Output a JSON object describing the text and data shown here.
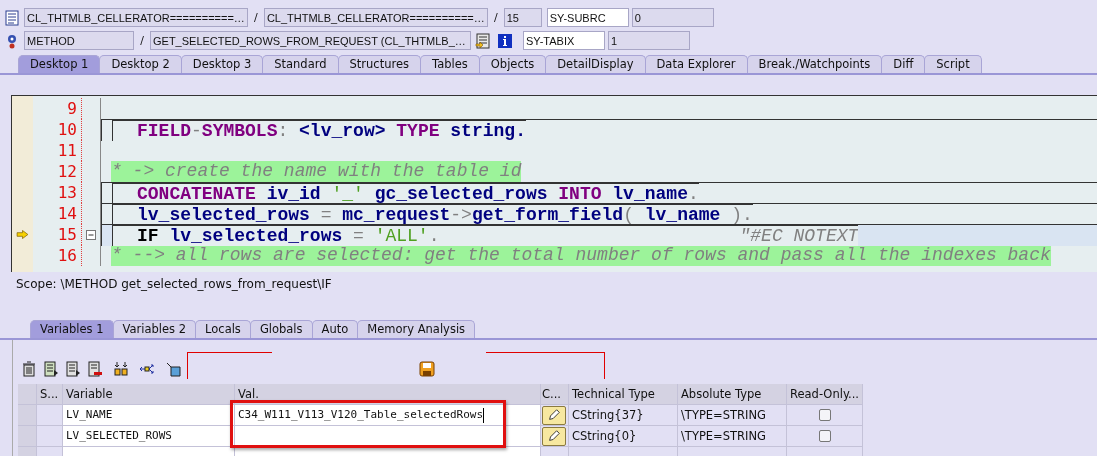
{
  "header": {
    "rows": [
      {
        "fields": [
          {
            "kind": "field",
            "text": "CL_THTMLB_CELLERATOR==========…"
          },
          {
            "kind": "sep",
            "text": "/"
          },
          {
            "kind": "field",
            "text": "CL_THTMLB_CELLERATOR==========…"
          },
          {
            "kind": "sep",
            "text": "/"
          },
          {
            "kind": "field",
            "text": "15"
          },
          {
            "kind": "label",
            "text": "SY-SUBRC"
          },
          {
            "kind": "field",
            "text": "0"
          }
        ]
      },
      {
        "fields": [
          {
            "kind": "field",
            "text": "METHOD"
          },
          {
            "kind": "sep",
            "text": "/"
          },
          {
            "kind": "field",
            "text": "GET_SELECTED_ROWS_FROM_REQUEST (CL_THTMLB_…"
          },
          {
            "kind": "icon"
          },
          {
            "kind": "label",
            "text": "SY-TABIX"
          },
          {
            "kind": "field",
            "text": "1"
          }
        ]
      }
    ]
  },
  "tabs": [
    {
      "label": "Desktop 1",
      "selected": true
    },
    {
      "label": "Desktop 2",
      "selected": false
    },
    {
      "label": "Desktop 3",
      "selected": false
    },
    {
      "label": "Standard",
      "selected": false
    },
    {
      "label": "Structures",
      "selected": false
    },
    {
      "label": "Tables",
      "selected": false
    },
    {
      "label": "Objects",
      "selected": false
    },
    {
      "label": "DetailDisplay",
      "selected": false
    },
    {
      "label": "Data Explorer",
      "selected": false
    },
    {
      "label": "Break./Watchpoints",
      "selected": false
    },
    {
      "label": "Diff",
      "selected": false
    },
    {
      "label": "Script",
      "selected": false
    }
  ],
  "code": {
    "lines": [
      {
        "number": "9",
        "kind": "blank",
        "current": false,
        "fold": false
      },
      {
        "number": "10",
        "kind": "code",
        "current": false,
        "fold": false,
        "segments": [
          {
            "kind": "kw",
            "text": "FIELD"
          },
          {
            "kind": "op",
            "text": "-"
          },
          {
            "kind": "kw",
            "text": "SYMBOLS"
          },
          {
            "kind": "op",
            "text": ":"
          },
          {
            "kind": "id",
            "text": " <lv_row> "
          },
          {
            "kind": "kw",
            "text": "TYPE"
          },
          {
            "kind": "id",
            "text": " string."
          }
        ]
      },
      {
        "number": "11",
        "kind": "blank",
        "current": false,
        "fold": false
      },
      {
        "number": "12",
        "kind": "comment",
        "current": false,
        "fold": false,
        "segments": [
          {
            "kind": "comment",
            "text": "* -> create the name with the table id"
          }
        ]
      },
      {
        "number": "13",
        "kind": "code",
        "current": false,
        "fold": false,
        "segments": [
          {
            "kind": "kw",
            "text": "CONCATENATE"
          },
          {
            "kind": "id",
            "text": " iv_id "
          },
          {
            "kind": "str",
            "text": "'_'"
          },
          {
            "kind": "id",
            "text": " gc_selected_rows "
          },
          {
            "kind": "kw",
            "text": "INTO"
          },
          {
            "kind": "id",
            "text": " lv_name"
          },
          {
            "kind": "op",
            "text": "."
          }
        ]
      },
      {
        "number": "14",
        "kind": "code",
        "current": false,
        "fold": false,
        "segments": [
          {
            "kind": "id",
            "text": "lv_selected_rows "
          },
          {
            "kind": "op",
            "text": "="
          },
          {
            "kind": "id",
            "text": " mc_request"
          },
          {
            "kind": "op",
            "text": "->"
          },
          {
            "kind": "id",
            "text": "get_form_field"
          },
          {
            "kind": "op",
            "text": "("
          },
          {
            "kind": "id",
            "text": " lv_name "
          },
          {
            "kind": "op",
            "text": ")."
          }
        ]
      },
      {
        "number": "15",
        "kind": "code",
        "current": true,
        "fold": true,
        "segments": [
          {
            "kind": "plain",
            "text": "IF"
          },
          {
            "kind": "id",
            "text": " lv_selected_rows "
          },
          {
            "kind": "op",
            "text": "="
          },
          {
            "kind": "str",
            "text": " 'ALL'"
          },
          {
            "kind": "op",
            "text": "."
          },
          {
            "kind": "note",
            "text": "\"#EC NOTEXT"
          }
        ]
      },
      {
        "number": "16",
        "kind": "comment",
        "current": false,
        "fold": false,
        "segments": [
          {
            "kind": "comment",
            "text": "* --> all rows are selected: get the total number of rows and pass all the indexes back"
          }
        ]
      }
    ]
  },
  "scope": "Scope: \\METHOD get_selected_rows_from_request\\IF",
  "subtabs": [
    {
      "label": "Variables 1",
      "selected": true
    },
    {
      "label": "Variables 2",
      "selected": false
    },
    {
      "label": "Locals",
      "selected": false
    },
    {
      "label": "Globals",
      "selected": false
    },
    {
      "label": "Auto",
      "selected": false
    },
    {
      "label": "Memory Analysis",
      "selected": false
    }
  ],
  "table": {
    "columns": [
      "S...",
      "Variable",
      "Val.",
      "C...",
      "Technical Type",
      "Absolute Type",
      "Read-Only..."
    ],
    "rows": [
      {
        "variable": "LV_NAME",
        "value": "C34_W111_V113_V120_Table_selectedRows",
        "technical_type": "CString{37}",
        "absolute_type": "\\TYPE=STRING",
        "read_only": false
      },
      {
        "variable": "LV_SELECTED_ROWS",
        "technical_type": "CString{0}",
        "absolute_type": "\\TYPE=STRING",
        "read_only": false
      }
    ]
  }
}
